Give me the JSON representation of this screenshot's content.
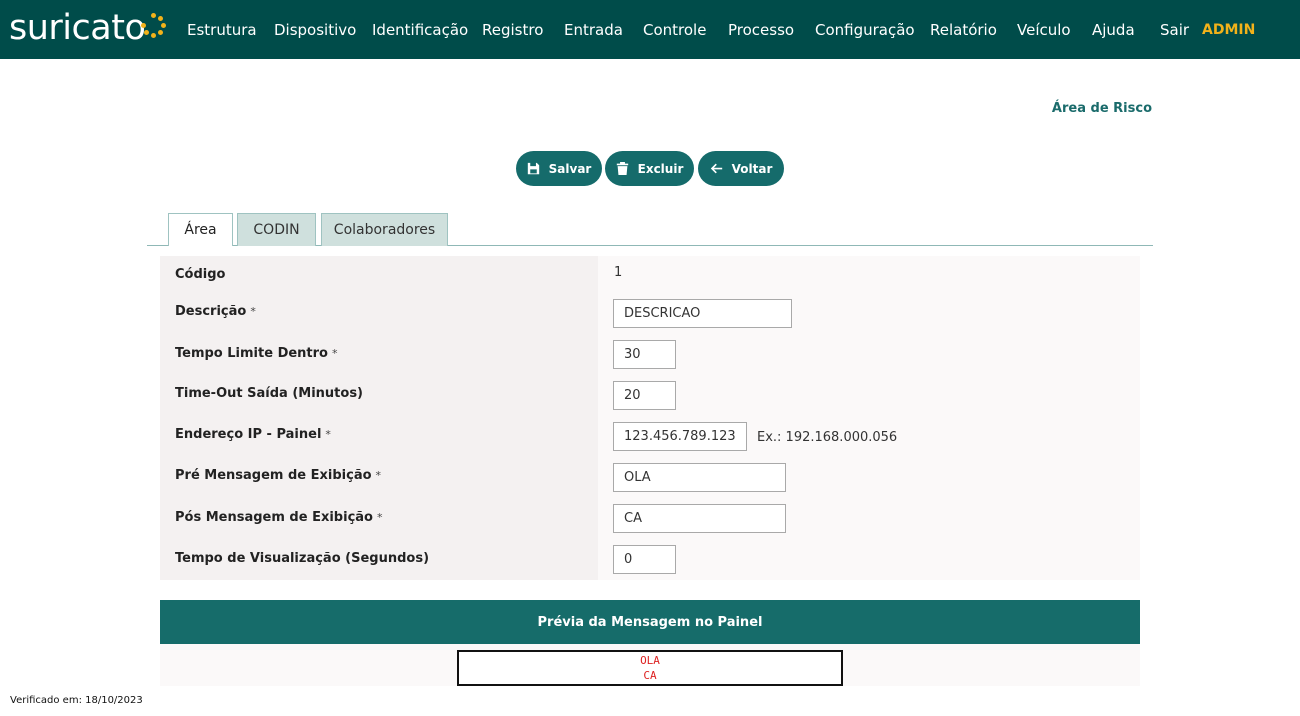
{
  "app": {
    "logo_text": "suricato",
    "nav": [
      "Estrutura",
      "Dispositivo",
      "Identificação",
      "Registro",
      "Entrada",
      "Controle",
      "Processo",
      "Configuração",
      "Relatório",
      "Veículo",
      "Ajuda",
      "Sair"
    ],
    "user": "ADMIN",
    "colors": {
      "header": "#004c4a",
      "accent": "#156b6b",
      "highlight": "#f2b21a"
    }
  },
  "page": {
    "breadcrumb": "Área de Risco"
  },
  "toolbar": {
    "save": {
      "label": "Salvar",
      "icon": "save-icon"
    },
    "delete": {
      "label": "Excluir",
      "icon": "trash-icon"
    },
    "back": {
      "label": "Voltar",
      "icon": "arrow-left-icon"
    }
  },
  "tabs": [
    {
      "label": "Área",
      "active": true
    },
    {
      "label": "CODIN",
      "active": false
    },
    {
      "label": "Colaboradores",
      "active": false
    }
  ],
  "form": {
    "codigo": {
      "label": "Código",
      "value": "1"
    },
    "descricao": {
      "label": "Descrição",
      "required": "*",
      "value": "DESCRICAO"
    },
    "tempo_limite": {
      "label": "Tempo Limite Dentro",
      "required": "*",
      "value": "30"
    },
    "timeout_saida": {
      "label": "Time-Out Saída (Minutos)",
      "value": "20"
    },
    "ip_painel": {
      "label": "Endereço IP - Painel",
      "required": "*",
      "value": "123.456.789.123",
      "hint": "Ex.: 192.168.000.056"
    },
    "pre_mensagem": {
      "label": "Pré Mensagem de Exibição",
      "required": "*",
      "value": "OLA"
    },
    "pos_mensagem": {
      "label": "Pós Mensagem de Exibição",
      "required": "*",
      "value": "CA"
    },
    "tempo_visualizacao": {
      "label": "Tempo de Visualização (Segundos)",
      "value": "0"
    }
  },
  "preview": {
    "title": "Prévia da Mensagem no Painel",
    "line1": "OLA",
    "line2": "CA"
  },
  "footer": {
    "verified": "Verificado em: 18/10/2023"
  }
}
